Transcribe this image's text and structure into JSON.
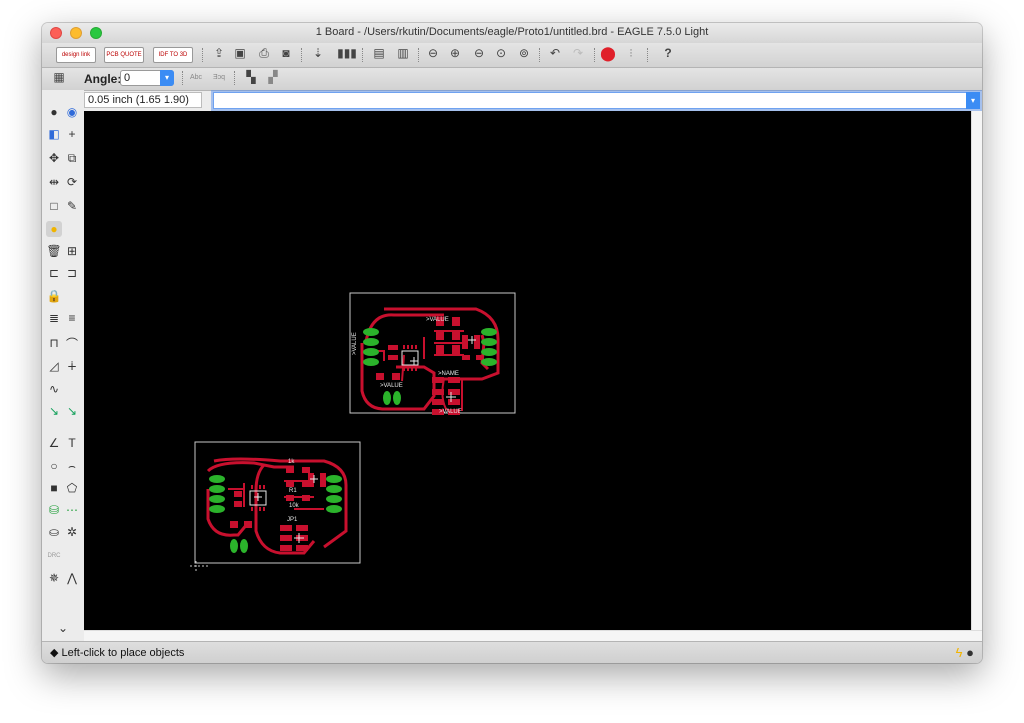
{
  "window": {
    "title": "1 Board - /Users/rkutin/Documents/eagle/Proto1/untitled.brd - EAGLE 7.5.0 Light"
  },
  "toolbar": {
    "design_link": "design link",
    "pcb_quote": "PCB QUOTE",
    "idf_to_3d": "IDF TO 3D"
  },
  "angle": {
    "label": "Angle:",
    "value": "0"
  },
  "command": {
    "coordinate": "0.05 inch (1.65 1.90)",
    "input_value": ""
  },
  "board1_labels": {
    "value_top": ">VALUE",
    "value_left": ">VALUE",
    "value_mid": ">VALUE",
    "name": ">NAME",
    "value_bottom": ">VALUE"
  },
  "board2_labels": {
    "label_1k": "1k",
    "label_r1": "R1",
    "label_10k": "10k",
    "label_jp1": "JP1"
  },
  "status": {
    "message": "Left-click to place objects"
  },
  "colors": {
    "canvas": "#000000",
    "copper": "#c8102e",
    "pad": "#2bb32b",
    "outline": "#c8c8c8"
  }
}
